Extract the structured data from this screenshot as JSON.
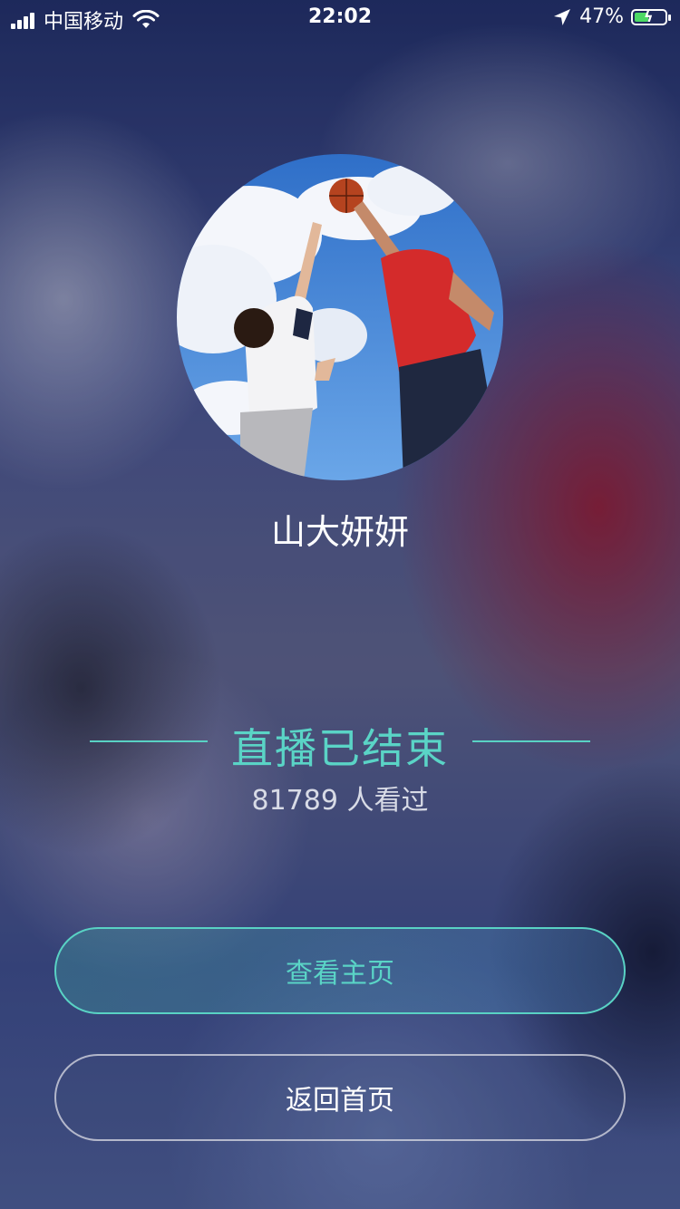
{
  "status_bar": {
    "carrier": "中国移动",
    "time": "22:02",
    "battery_percent": "47%",
    "icons": [
      "signal-icon",
      "wifi-icon",
      "location-icon",
      "battery-charging-icon"
    ]
  },
  "profile": {
    "avatar_icon": "basketball-photo-avatar",
    "username": "山大妍妍"
  },
  "live_end": {
    "title": "直播已结束",
    "viewer_count": "81789 人看过"
  },
  "buttons": {
    "view_profile": "查看主页",
    "back_home": "返回首页"
  },
  "colors": {
    "accent": "#5ad4c6",
    "text_primary": "#ffffff",
    "battery_fill": "#4cd964"
  }
}
